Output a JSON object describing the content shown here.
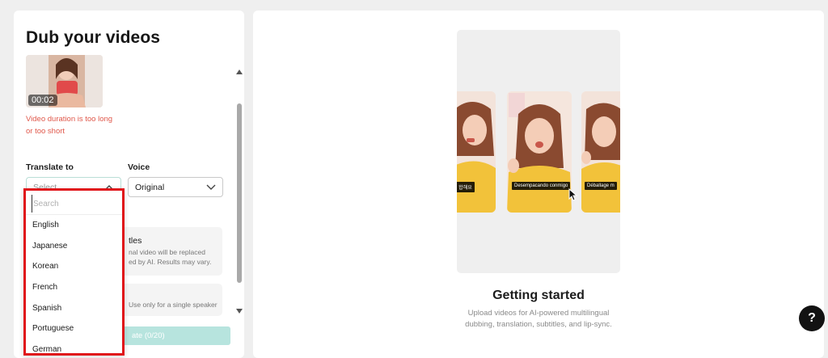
{
  "left_panel": {
    "title": "Dub your videos",
    "video": {
      "duration": "00:02",
      "error": "Video duration is too long or too short"
    },
    "translate_to": {
      "label": "Translate to",
      "placeholder": "Select"
    },
    "voice": {
      "label": "Voice",
      "value": "Original"
    },
    "subtitles_card": {
      "title": "tles",
      "desc_line1": "nal video will be replaced",
      "desc_line2": "ed by AI. Results may vary."
    },
    "speaker_card": {
      "desc": "Use only for a single speaker"
    },
    "translate_button": "ate (0/20)"
  },
  "dropdown": {
    "search_placeholder": "Search",
    "languages": [
      "English",
      "Japanese",
      "Korean",
      "French",
      "Spanish",
      "Portuguese",
      "German"
    ]
  },
  "preview": {
    "captions": [
      "이 합해요",
      "Desempacando conmigo",
      "Déballage m"
    ],
    "title": "Getting started",
    "description": "Upload videos for AI-powered multilingual dubbing, translation, subtitles, and lip-sync."
  },
  "help": {
    "label": "?"
  },
  "colors": {
    "highlight_border": "#e0141a",
    "error": "#e0584b",
    "accent_button": "#b7e4de"
  }
}
